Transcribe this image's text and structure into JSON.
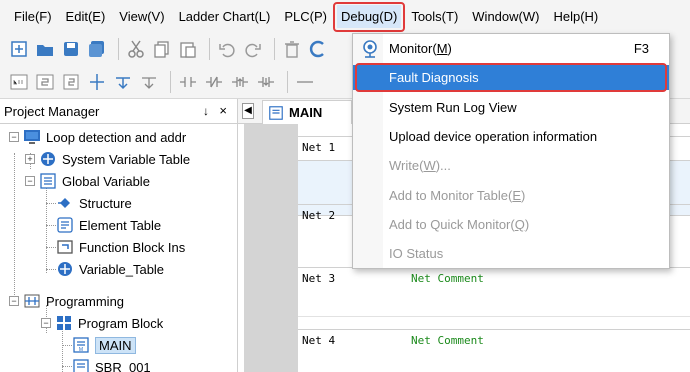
{
  "menubar": {
    "items": [
      {
        "label": "File(F)"
      },
      {
        "label": "Edit(E)"
      },
      {
        "label": "View(V)"
      },
      {
        "label": "Ladder Chart(L)"
      },
      {
        "label": "PLC(P)"
      },
      {
        "label": "Debug(D)"
      },
      {
        "label": "Tools(T)"
      },
      {
        "label": "Window(W)"
      },
      {
        "label": "Help(H)"
      }
    ]
  },
  "debug_menu": {
    "items": [
      {
        "label_pre": "Monitor(",
        "label_key": "M",
        "label_post": ")",
        "shortcut": "F3",
        "icon": "monitor-icon"
      },
      {
        "label": "Fault Diagnosis"
      },
      {
        "label": "System Run Log View"
      },
      {
        "label": "Upload device operation information"
      },
      {
        "label_pre": "Write(",
        "label_key": "W",
        "label_post": ")..."
      },
      {
        "label_pre": "Add to Monitor Table(",
        "label_key": "E",
        "label_post": ")"
      },
      {
        "label_pre": "Add to Quick Monitor(",
        "label_key": "Q",
        "label_post": ")"
      },
      {
        "label": "IO Status"
      }
    ]
  },
  "project_manager": {
    "title": "Project Manager",
    "pin": "↓",
    "close": "×",
    "tree": [
      {
        "label": "Loop detection and addr",
        "icon": "monitor-icon"
      },
      {
        "label": "System Variable Table",
        "icon": "variable-table-icon"
      },
      {
        "label": "Global Variable",
        "icon": "list-icon"
      },
      {
        "label": "Structure",
        "icon": "structure-icon"
      },
      {
        "label": "Element Table",
        "icon": "element-table-icon"
      },
      {
        "label": "Function Block Ins",
        "icon": "function-block-icon"
      },
      {
        "label": "Variable_Table",
        "icon": "variable-table-icon"
      },
      {
        "label": "Programming",
        "icon": "ladder-icon"
      },
      {
        "label": "Program Block",
        "icon": "program-block-icon"
      },
      {
        "label": "MAIN",
        "icon": "program-file-icon"
      },
      {
        "label": "SBR_001",
        "icon": "program-file-icon"
      }
    ]
  },
  "editor": {
    "tab_label": "MAIN",
    "tab_scroll": "◀",
    "networks": [
      {
        "label": "Net 1",
        "comment": ""
      },
      {
        "label": "Net 2",
        "comment": ""
      },
      {
        "label": "Net 3",
        "comment": "Net Comment"
      },
      {
        "label": "Net 4",
        "comment": "Net Comment"
      }
    ]
  },
  "colors": {
    "highlight_red": "#e03a3a",
    "selection_blue": "#2f7fd7",
    "comment_green": "#1b8a1b"
  }
}
